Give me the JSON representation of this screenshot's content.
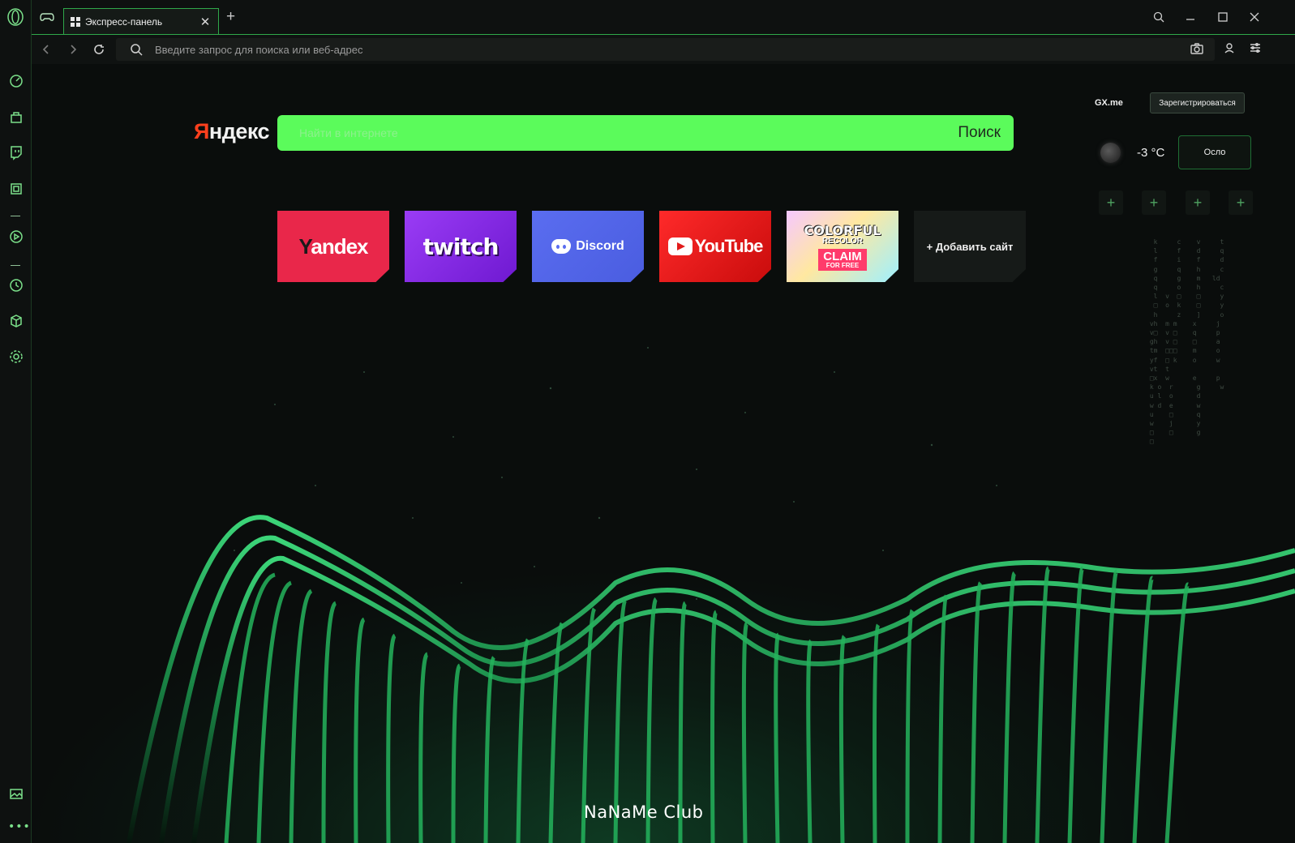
{
  "window": {
    "tab_title": "Экспресс-панель"
  },
  "addressbar": {
    "placeholder": "Введите запрос для поиска или веб-адрес"
  },
  "search": {
    "logo": "Яндекс",
    "logo_first": "Я",
    "logo_rest": "ндекс",
    "placeholder": "Найти в интернете",
    "button": "Поиск"
  },
  "speed_dial": {
    "tiles": [
      {
        "name": "Yandex",
        "label_first": "Y",
        "label_rest": "andex",
        "color": "#e9274a"
      },
      {
        "name": "Twitch",
        "label": "twitch",
        "color": "#9a3cf5"
      },
      {
        "name": "Discord",
        "label": "Discord",
        "color": "#5a6df0"
      },
      {
        "name": "YouTube",
        "label": "YouTube",
        "color": "#ff2a2a"
      },
      {
        "name": "Colorful Recolor",
        "label": "COLORFUL",
        "label2": "RECOLOR",
        "badge": "CLAIM",
        "badge_sub": "FOR FREE"
      },
      {
        "name": "add",
        "label": "+ Добавить сайт"
      }
    ]
  },
  "widget": {
    "gx_label": "GX.me",
    "register": "Зарегистрироваться",
    "temperature": "-3 °C",
    "city": "Осло",
    "plus": [
      "+",
      "+",
      "+",
      "+"
    ]
  },
  "footer": {
    "brand": "NaNaMe Club"
  },
  "colors": {
    "accent": "#5bfb5b",
    "sidebar_icon": "#7be08a",
    "tab_border": "#2fa84a"
  },
  "icons": {
    "sidebar": [
      "speed-dial-icon",
      "shopping-icon",
      "twitch-icon",
      "tasks-icon",
      "player-icon",
      "history-icon",
      "extensions-icon",
      "settings-icon",
      "wallpaper-icon"
    ]
  }
}
